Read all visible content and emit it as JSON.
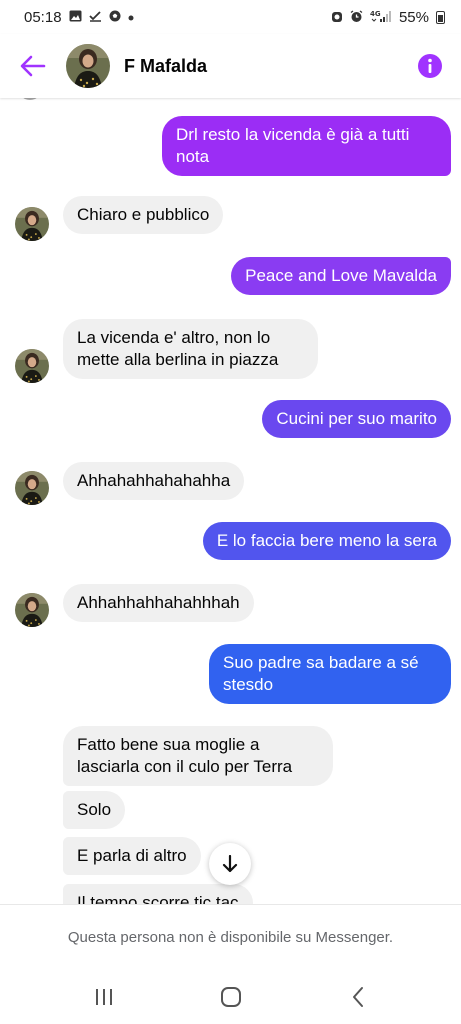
{
  "status_bar": {
    "time": "05:18",
    "battery": "55%",
    "left_icons": [
      "gallery-icon",
      "check-icon",
      "soccer-ball-icon",
      "dot-icon"
    ],
    "right_icons": [
      "alarm-icon",
      "clock-icon",
      "4g-signal-icon",
      "battery-icon"
    ]
  },
  "header": {
    "contact_name": "F Mafalda",
    "colors": {
      "accent": "#a033ff"
    }
  },
  "messages": [
    {
      "direction": "out",
      "text": "Drl resto la vicenda è già a tutti nota",
      "color": "#9b2df5"
    },
    {
      "direction": "in",
      "text": "Chiaro e pubblico"
    },
    {
      "direction": "out",
      "text": "Peace and Love Mavalda",
      "color": "#8a3cf2"
    },
    {
      "direction": "in",
      "text": "La vicenda e' altro, non lo mette alla berlina in piazza"
    },
    {
      "direction": "out",
      "text": "Cucini per suo marito",
      "color": "#6a48ef"
    },
    {
      "direction": "in",
      "text": "Ahhahahhahahahha"
    },
    {
      "direction": "out",
      "text": "E lo faccia bere meno la sera",
      "color": "#5155ee"
    },
    {
      "direction": "in",
      "text": "Ahhahhahhahahhhah"
    },
    {
      "direction": "out",
      "text": "Suo padre sa badare a sé stesdo",
      "color": "#3162f0"
    },
    {
      "direction": "in",
      "text": "Fatto bene sua moglie a lasciarla con il culo per Terra"
    },
    {
      "direction": "in",
      "text": "Solo"
    },
    {
      "direction": "in",
      "text": "E parla di altro"
    },
    {
      "direction": "in",
      "text": "Il tempo scorre tic tac"
    }
  ],
  "footer": {
    "notice": "Questa persona non è disponibile su Messenger."
  }
}
